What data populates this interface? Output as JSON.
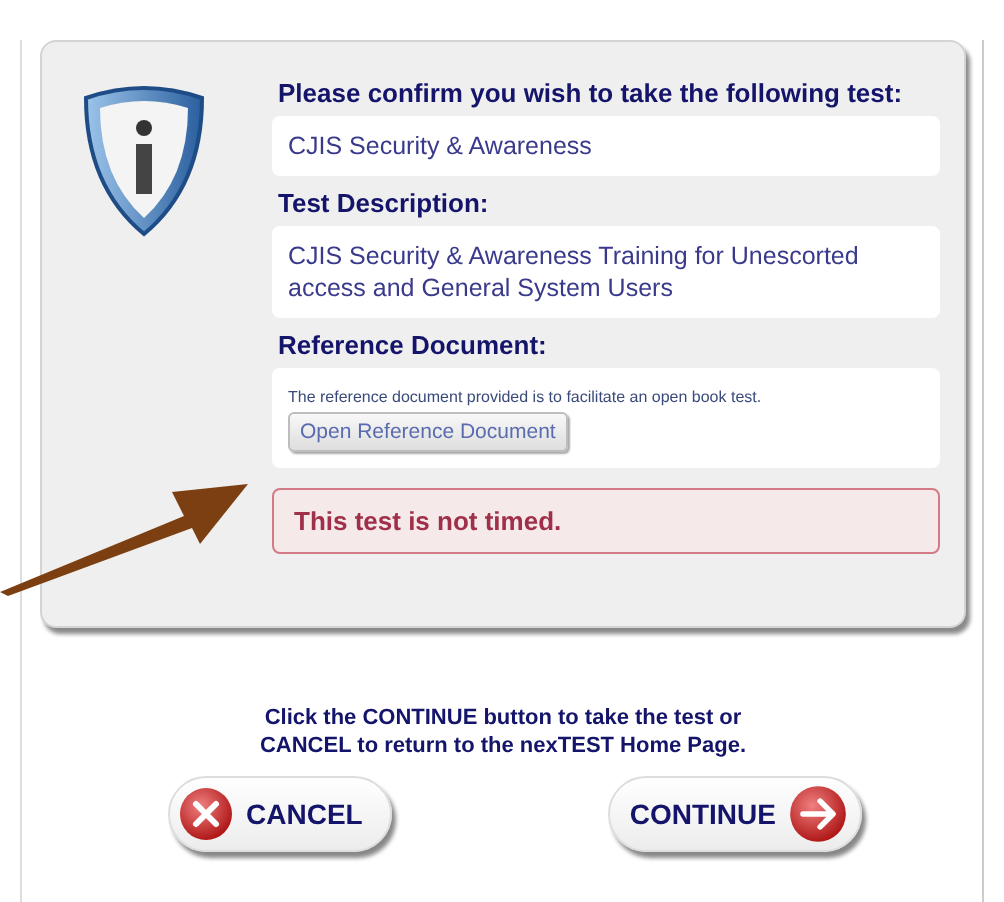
{
  "dialog": {
    "heading": "Please confirm you wish to take the following test:",
    "test_name": "CJIS Security & Awareness",
    "description_label": "Test Description:",
    "description": "CJIS Security & Awareness Training for Unescorted access and General System Users",
    "reference_label": "Reference Document:",
    "reference_note": "The reference document provided is to facilitate an open book test.",
    "reference_button": "Open Reference Document",
    "timing_notice": "This test is not timed."
  },
  "instructions": [
    "Click the CONTINUE button to take the test or",
    "CANCEL to return to the nexTEST Home Page."
  ],
  "buttons": [
    {
      "kind": "cancel",
      "label": "CANCEL"
    },
    {
      "kind": "continue",
      "label": "CONTINUE"
    }
  ]
}
